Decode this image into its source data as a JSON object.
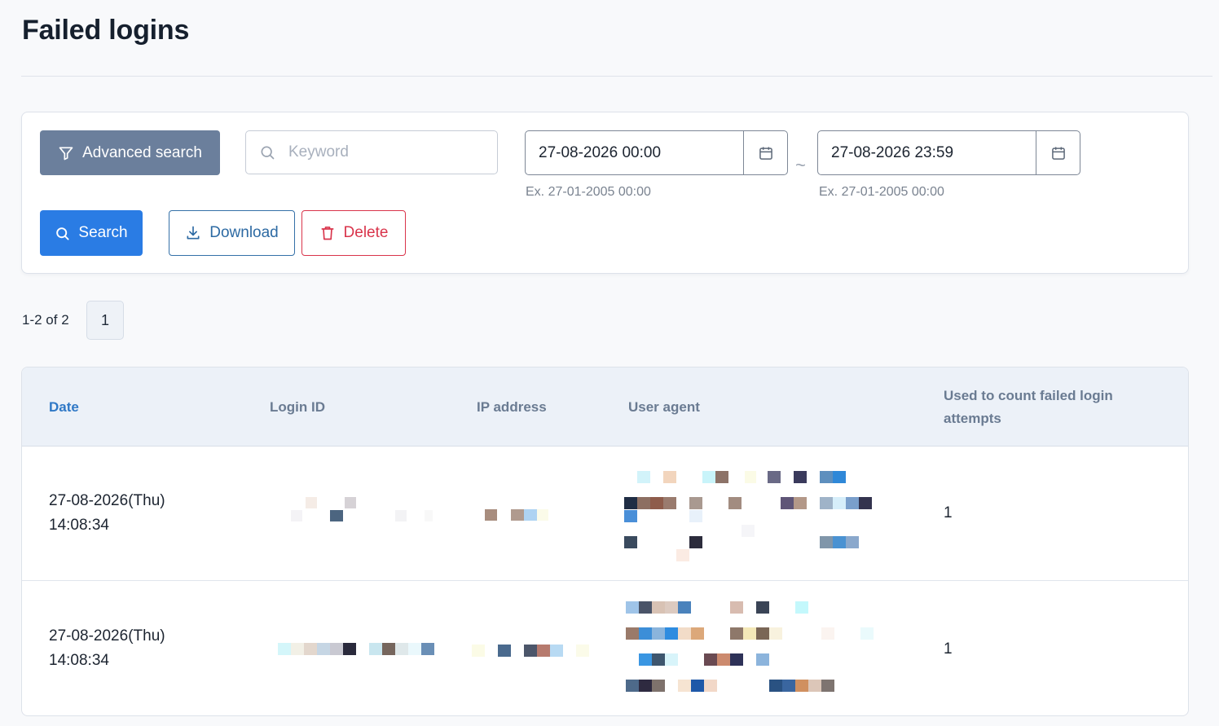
{
  "page": {
    "title": "Failed logins"
  },
  "filters": {
    "advanced_search_label": "Advanced search",
    "keyword_placeholder": "Keyword",
    "keyword_value": "",
    "date_from": "27-08-2026 00:00",
    "date_to": "27-08-2026 23:59",
    "date_separator": "~",
    "date_hint": "Ex. 27-01-2005 00:00",
    "search_label": "Search",
    "download_label": "Download",
    "delete_label": "Delete"
  },
  "pagination": {
    "summary": "1-2 of 2",
    "current_page": "1"
  },
  "table": {
    "headers": {
      "date": "Date",
      "login_id": "Login ID",
      "ip_address": "IP address",
      "user_agent": "User agent",
      "count": "Used to count failed login attempts"
    },
    "rows": [
      {
        "date": "27-08-2026(Thu)",
        "time": "14:08:34",
        "login_id": "[redacted]",
        "ip_address": "[redacted]",
        "user_agent": "[redacted]",
        "count": "1"
      },
      {
        "date": "27-08-2026(Thu)",
        "time": "14:08:34",
        "login_id": "[redacted]",
        "ip_address": "[redacted]",
        "user_agent": "[redacted]",
        "count": "1"
      }
    ]
  },
  "colors": {
    "primary": "#2a7ce4",
    "advanced_button": "#6b7f9c",
    "danger": "#d9344b",
    "header_bg": "#ecf1f8",
    "sorted_column": "#2f78c6"
  }
}
